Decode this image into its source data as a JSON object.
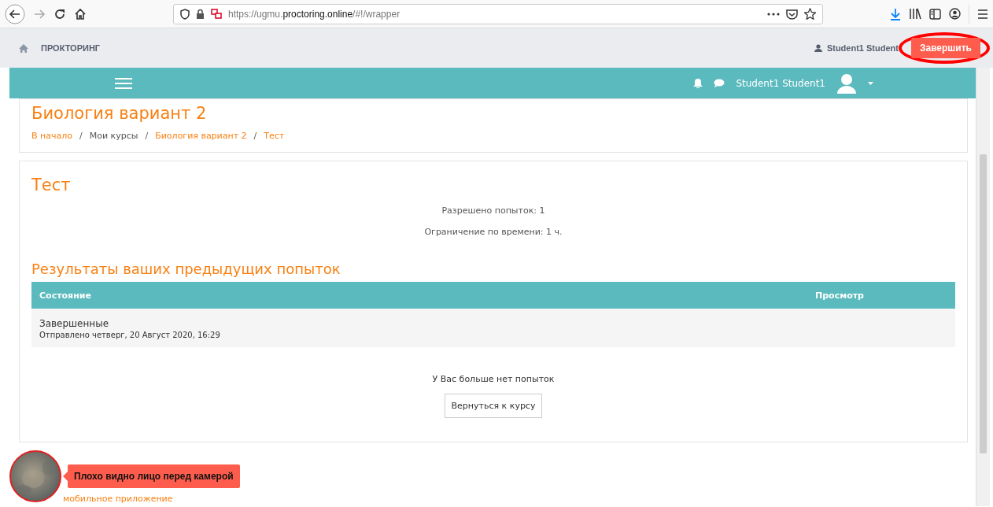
{
  "browser": {
    "url_prefix": "https://ugmu.",
    "url_domain": "proctoring.online",
    "url_suffix": "/#!/wrapper"
  },
  "proctoring_bar": {
    "title": "ПРОКТОРИНГ",
    "user": "Student1 Student",
    "finish_button": "Завершить",
    "finish_highlighted": true
  },
  "navbar": {
    "user": "Student1 Student1"
  },
  "course": {
    "title": "Биология вариант 2",
    "separator": "/",
    "breadcrumbs": [
      {
        "label": "В начало",
        "link": true
      },
      {
        "label": "Мои курсы",
        "link": false
      },
      {
        "label": "Биология вариант 2",
        "link": true
      },
      {
        "label": "Тест",
        "link": true
      }
    ]
  },
  "quiz": {
    "title": "Тест",
    "info": [
      "Разрешено попыток: 1",
      "Ограничение по времени: 1 ч."
    ],
    "results_heading": "Результаты ваших предыдущих попыток",
    "table": {
      "columns": [
        "Состояние",
        "Просмотр"
      ],
      "rows": [
        {
          "state": "Завершенные",
          "submitted": "Отправлено четверг, 20 Август 2020, 16:29"
        }
      ]
    },
    "no_attempts": "У Вас больше нет попыток",
    "back_button": "Вернуться к курсу"
  },
  "camera": {
    "warning": "Плохо видно лицо перед камерой"
  },
  "footer": {
    "link": "мобильное приложение"
  }
}
